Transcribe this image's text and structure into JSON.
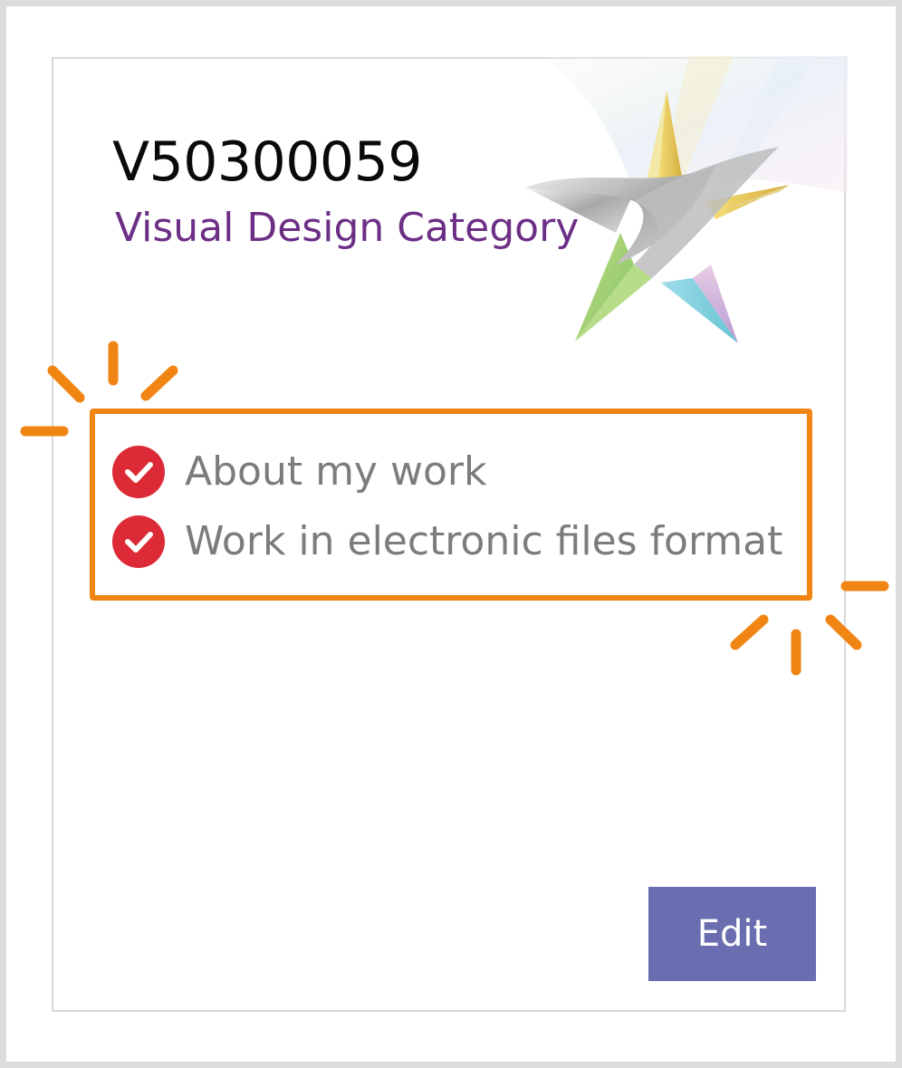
{
  "card": {
    "title": "V50300059",
    "subtitle": "Visual Design Category",
    "checklist": [
      {
        "label": "About my work",
        "status": "complete",
        "icon": "check-circle-icon"
      },
      {
        "label": "Work in electronic files format",
        "status": "complete",
        "icon": "check-circle-icon"
      }
    ],
    "edit_label": "Edit"
  },
  "colors": {
    "highlight": "#f08513",
    "subtitle": "#6d2f86",
    "check": "#dc2b37",
    "button": "#6a6daf"
  }
}
